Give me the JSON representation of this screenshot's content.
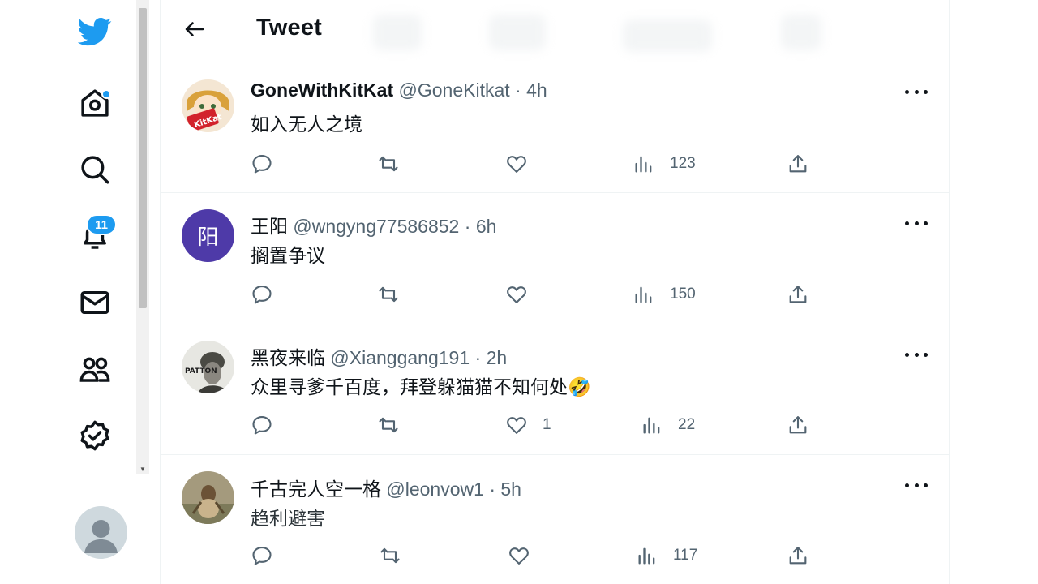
{
  "header": {
    "title": "Tweet"
  },
  "nav": {
    "notifications_badge": "11",
    "icons": [
      "twitter-logo-icon",
      "home-icon",
      "search-icon",
      "bell-icon",
      "mail-icon",
      "communities-icon",
      "verified-icon"
    ]
  },
  "colors": {
    "brand": "#1d9bf0",
    "text": "#0f1419",
    "muted": "#536471",
    "avatar_purple": "#4e3aa8"
  },
  "replies": [
    {
      "name": "GoneWithKitKat",
      "handle": "@GoneKitkat",
      "sep": "·",
      "time": "4h",
      "text": "如入无人之境",
      "likes": "",
      "views": "123"
    },
    {
      "name": "王阳",
      "handle": "@wngyng77586852",
      "sep": "·",
      "time": "6h",
      "text": "搁置争议",
      "likes": "",
      "views": "150",
      "avatar_letter": "阳"
    },
    {
      "name": "黑夜来临",
      "handle": "@Xianggang191",
      "sep": "·",
      "time": "2h",
      "text": "众里寻爹千百度，拜登躲猫猫不知何处🤣",
      "likes": "1",
      "views": "22"
    },
    {
      "name": "千古完人空一格",
      "handle": "@leonvow1",
      "sep": "·",
      "time": "5h",
      "text": "趋利避害",
      "likes": "",
      "views": "117"
    }
  ]
}
